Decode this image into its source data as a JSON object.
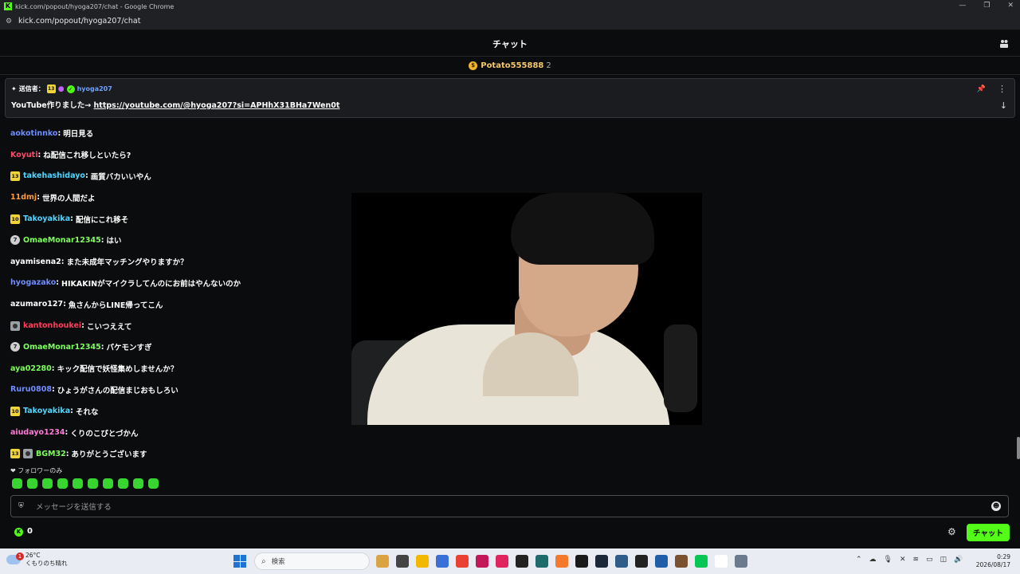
{
  "browser": {
    "window_title": "kick.com/popout/hyoga207/chat - Google Chrome",
    "url": "kick.com/popout/hyoga207/chat"
  },
  "header": {
    "title": "チャット"
  },
  "gift_bar": {
    "username": "Potato555888",
    "count": "2"
  },
  "pinned": {
    "label": "送信者：",
    "sub_badge": "13",
    "username": "hyoga207",
    "text_prefix": "YouTube作りました→ ",
    "link": "https://youtube.com/@hyoga207?si=APHhX31BHa7Wen0t"
  },
  "messages": [
    {
      "badge": "",
      "user": "aokotinnko",
      "color": "#6f8cff",
      "text": "明日見る"
    },
    {
      "badge": "",
      "user": "Koyuti",
      "color": "#ff4a6a",
      "text": "ね配信これ移しといたら?"
    },
    {
      "badge": "13",
      "user": "takehashidayo",
      "color": "#4fd6ff",
      "text": "画質バカいいやん"
    },
    {
      "badge": "",
      "user": "11dmj",
      "color": "#ff9a3c",
      "text": "世界の人間だよ"
    },
    {
      "badge": "10",
      "user": "Takoyakika",
      "color": "#4fd6ff",
      "text": "配信にこれ移そ"
    },
    {
      "badge": "og",
      "user": "OmaeMonar12345",
      "color": "#7cff5a",
      "text": "はい"
    },
    {
      "badge": "",
      "user": "ayamisena2",
      "color": "#ffffff",
      "text": "また未成年マッチングやりますか？"
    },
    {
      "badge": "",
      "user": "hyogazako",
      "color": "#6f8cff",
      "text": "HIKAKINがマイクラしてんのにお前はやんないのか"
    },
    {
      "badge": "",
      "user": "azumaro127",
      "color": "#ffffff",
      "text": "魚さんからLINE帰ってこん"
    },
    {
      "badge": "avatar",
      "user": "kantonhoukei",
      "color": "#ff3c5a",
      "text": "こいつええて"
    },
    {
      "badge": "og",
      "user": "OmaeMonar12345",
      "color": "#7cff5a",
      "text": "パケモンすぎ"
    },
    {
      "badge": "",
      "user": "aya02280",
      "color": "#7cff5a",
      "text": "キック配信で妖怪集めしませんか？"
    },
    {
      "badge": "",
      "user": "Ruru0808",
      "color": "#6f8cff",
      "text": "ひょうがさんの配信まじおもしろい"
    },
    {
      "badge": "10",
      "user": "Takoyakika",
      "color": "#4fd6ff",
      "text": "それな"
    },
    {
      "badge": "",
      "user": "aiudayo1234",
      "color": "#ff7ad6",
      "text": "くりのこびとづかん"
    },
    {
      "badge": "13+avatar",
      "user": "BGM32",
      "color": "#7cff5a",
      "text": "ありがとうございます"
    }
  ],
  "follower_mode": "❤ フォロワーのみ",
  "emotes": [
    "emote-1",
    "emote-2",
    "emote-3",
    "emote-4",
    "emote-5",
    "emote-6",
    "emote-7",
    "emote-8",
    "emote-9",
    "emote-10"
  ],
  "input": {
    "placeholder": "メッセージを送信する"
  },
  "footer": {
    "count": "0",
    "send_label": "チャット"
  },
  "taskbar": {
    "temp": "26°C",
    "weather": "くもりのち晴れ",
    "alert": "1",
    "search_placeholder": "検索",
    "time": "0:29",
    "date": "2026/08/17"
  },
  "accent": "#53fc18"
}
